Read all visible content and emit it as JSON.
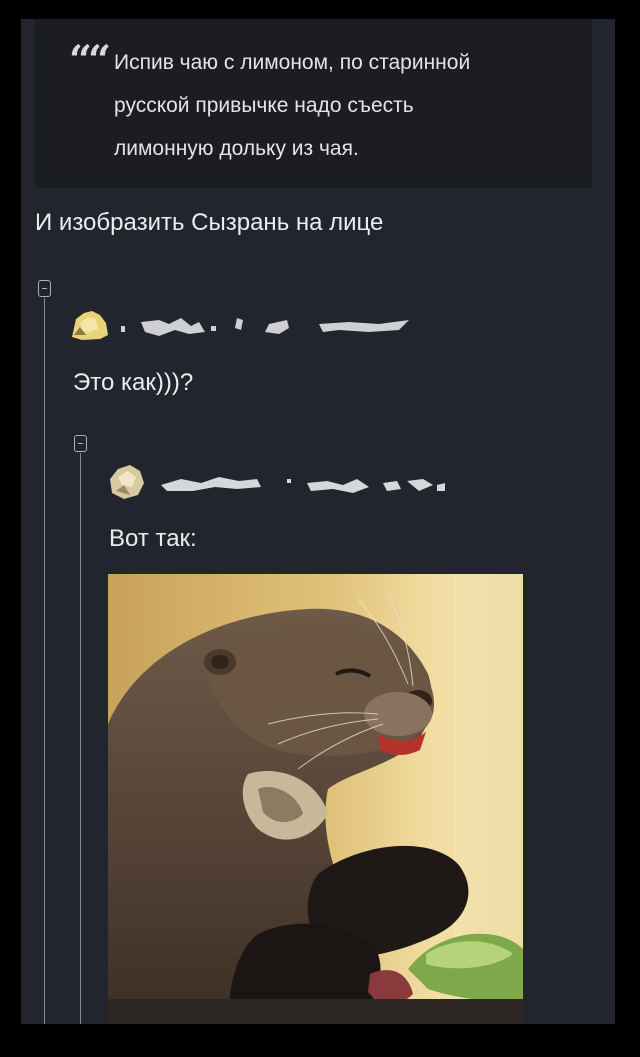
{
  "quote": {
    "mark": "❝",
    "lines": [
      "Испив чаю с лимоном, по старинной",
      "русской привычке надо съесть",
      "лимонную дольку из чая."
    ]
  },
  "reply": {
    "text": "И изобразить Сызрань на лице"
  },
  "comments": [
    {
      "text": "Это как)))?"
    },
    {
      "text": "Вот так:"
    }
  ],
  "icons": {
    "collapse": "collapse-minus-icon",
    "avatar": "avatar-icon"
  },
  "colors": {
    "background": "#22252d",
    "quote_background": "#1b1d23",
    "text": "#ececec",
    "thread_line": "#8a8d94"
  }
}
